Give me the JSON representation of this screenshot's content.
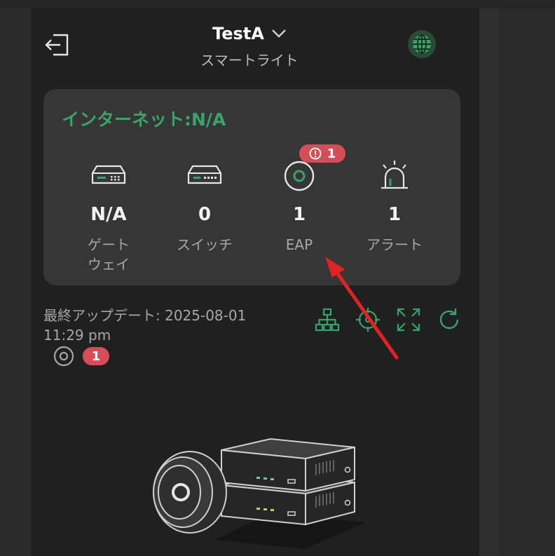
{
  "header": {
    "title": "TestA",
    "subtitle": "スマートライト"
  },
  "card": {
    "internet_label": "インターネット:N/A",
    "stats": [
      {
        "value": "N/A",
        "label": "ゲート\nウェイ",
        "icon": "gateway-icon"
      },
      {
        "value": "0",
        "label": "スイッチ",
        "icon": "switch-icon"
      },
      {
        "value": "1",
        "label": "EAP",
        "icon": "eap-icon"
      },
      {
        "value": "1",
        "label": "アラート",
        "icon": "alert-siren-icon"
      }
    ],
    "eap_alert_badge": "1"
  },
  "update": {
    "text": "最終アップデート: 2025-08-01\n11:29 pm"
  },
  "filter_badge": "1",
  "colors": {
    "accent_green": "#3aa26a",
    "badge_red": "#d64d57",
    "annotation_red": "#e22222"
  }
}
